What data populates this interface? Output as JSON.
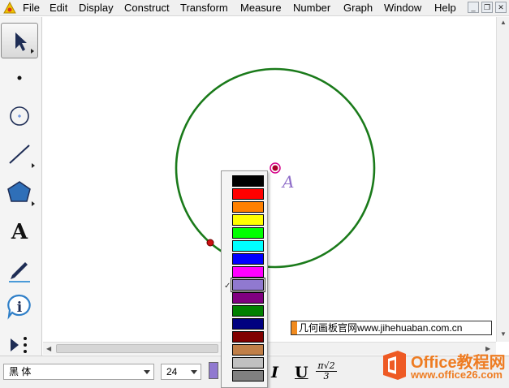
{
  "menu": {
    "items": [
      "File",
      "Edit",
      "Display",
      "Construct",
      "Transform",
      "Measure",
      "Number",
      "Graph",
      "Window",
      "Help"
    ]
  },
  "window_controls": {
    "minimize": "_",
    "restore": "❐",
    "close": "✕"
  },
  "toolbar": {
    "tools": [
      {
        "name": "selection-arrow-tool",
        "icon": "arrow-cursor-icon",
        "selected": true
      },
      {
        "name": "point-tool",
        "icon": "point-icon"
      },
      {
        "name": "compass-tool",
        "icon": "circle-icon"
      },
      {
        "name": "straightedge-tool",
        "icon": "segment-icon"
      },
      {
        "name": "polygon-tool",
        "icon": "pentagon-icon"
      },
      {
        "name": "text-tool",
        "icon": "text-icon",
        "glyph": "A"
      },
      {
        "name": "marker-tool",
        "icon": "pen-icon"
      },
      {
        "name": "information-tool",
        "icon": "info-icon",
        "glyph": "i"
      },
      {
        "name": "custom-tool",
        "icon": "custom-tool-icon"
      }
    ]
  },
  "canvas": {
    "point_label": "A",
    "circle_color": "#1a7a1a",
    "center_color": "#c0004a",
    "radius_point_color": "#cc1010"
  },
  "text_style_bar": {
    "font": "黑 体",
    "size": "24",
    "current_color": "#9079d0",
    "italic": "I",
    "underline": "U",
    "symbol_top": "π√2",
    "symbol_bottom": "3"
  },
  "color_palette": {
    "colors": [
      "#000000",
      "#ff0000",
      "#ff8000",
      "#ffff00",
      "#00ff00",
      "#00ffff",
      "#0000ff",
      "#ff00ff",
      "#9079d0",
      "#800080",
      "#008000",
      "#000080",
      "#800000",
      "#c07f48",
      "#c0c0c0",
      "#808080"
    ],
    "selected_index": 8,
    "check_mark": "✓"
  },
  "watermark": {
    "text": "几何画板官网www.jihehuaban.com.cn",
    "logo_main": "Office教程网",
    "logo_url": "www.office26.com"
  }
}
